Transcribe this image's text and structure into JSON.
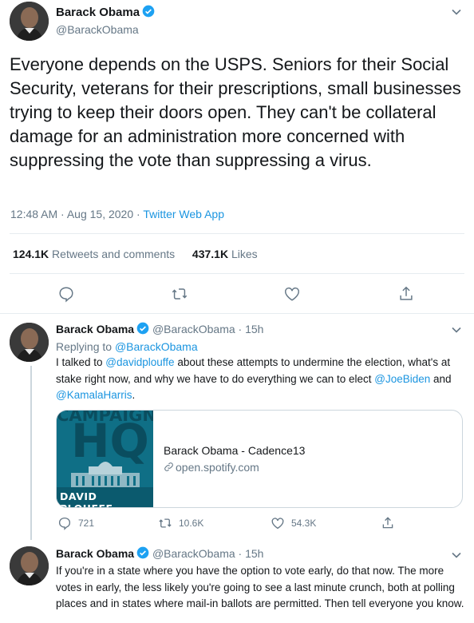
{
  "main_tweet": {
    "author_name": "Barack Obama",
    "author_handle": "@BarackObama",
    "text": "Everyone depends on the USPS. Seniors for their Social Security, veterans for their prescriptions, small businesses trying to keep their doors open. They can't be collateral damage for an administration more concerned with suppressing the vote than suppressing a virus.",
    "time": "12:48 AM · Aug 15, 2020 · ",
    "source": "Twitter Web App",
    "retweets_count": "124.1K",
    "retweets_label": "Retweets and comments",
    "likes_count": "437.1K",
    "likes_label": "Likes",
    "icons": [
      "reply-icon",
      "retweet-icon",
      "like-icon",
      "share-icon"
    ]
  },
  "reply1": {
    "author_name": "Barack Obama",
    "author_handle": "@BarackObama",
    "dot": "·",
    "age": "15h",
    "replying_prefix": "Replying to ",
    "replying_handle": "@BarackObama",
    "text_1": "I talked to ",
    "mention_1": "@davidplouffe",
    "text_2": " about these attempts to undermine the election, what's at stake right now, and why we have to do everything we can to elect ",
    "mention_2": "@JoeBiden",
    "text_3": " and ",
    "mention_3": "@KamalaHarris",
    "text_4": ".",
    "card": {
      "image_text_1": "CAMPAIGN",
      "image_text_2": "HQ",
      "image_text_3": "DAVID PLOUFFE",
      "title": "Barack Obama - Cadence13",
      "domain": "open.spotify.com"
    },
    "reply_count": "721",
    "retweet_count": "10.6K",
    "like_count": "54.3K"
  },
  "reply2": {
    "author_name": "Barack Obama",
    "author_handle": "@BarackObama",
    "dot": "·",
    "age": "15h",
    "text": "If you're in a state where you have the option to vote early, do that now. The more votes in early, the less likely you're going to see a last minute crunch, both at polling places and in states where mail-in ballots are permitted. Then tell everyone you know."
  },
  "colors": {
    "accent": "#1b95e0",
    "muted": "#657786",
    "border": "#e6ecf0"
  }
}
